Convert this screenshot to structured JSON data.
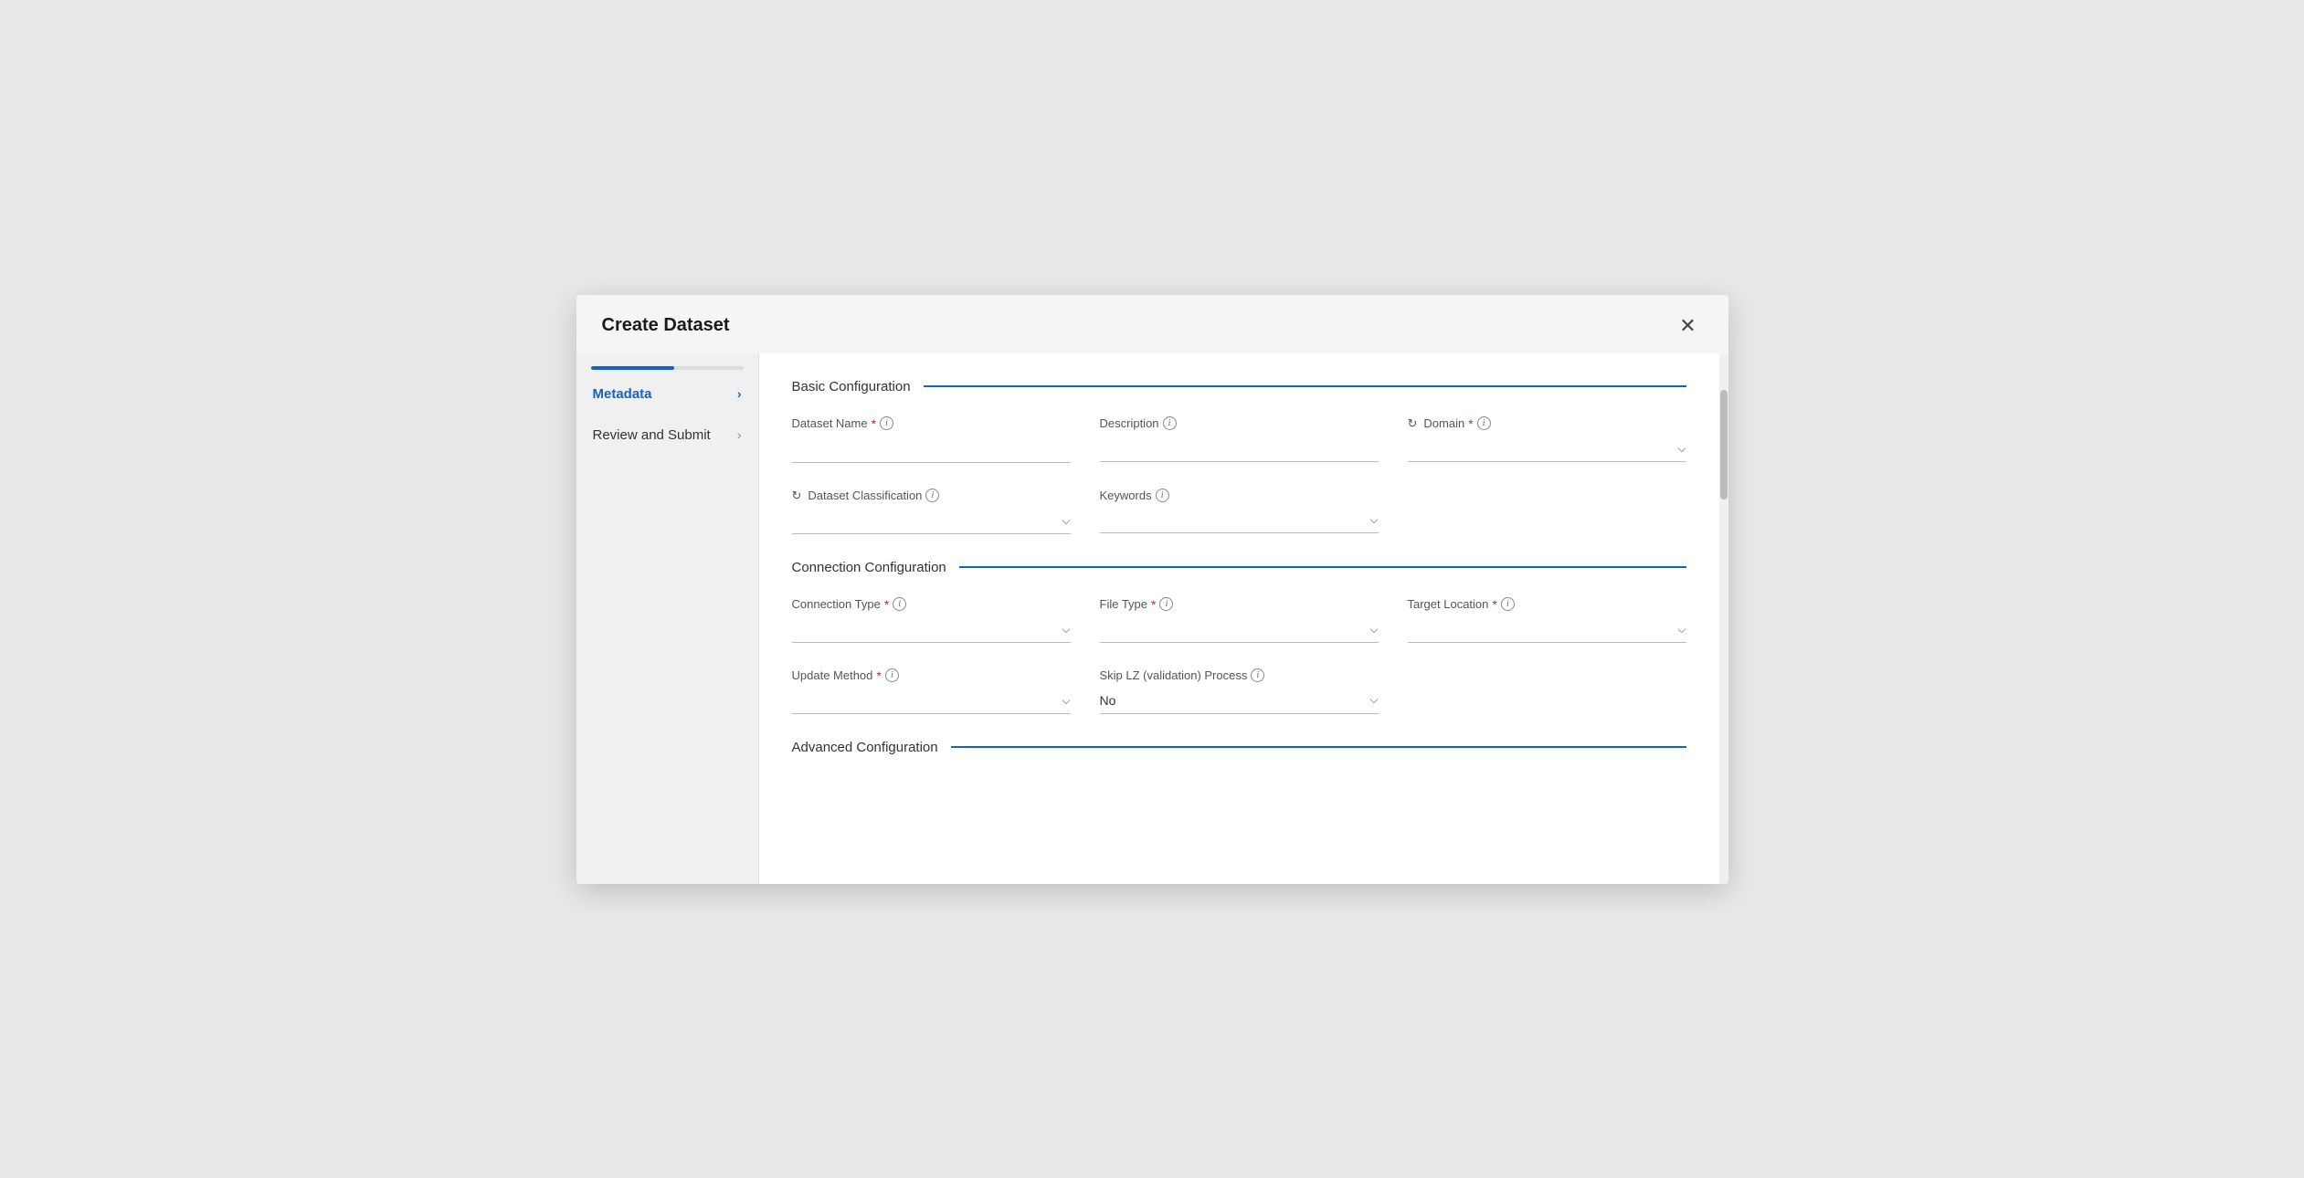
{
  "modal": {
    "title": "Create Dataset",
    "close_label": "×"
  },
  "sidebar": {
    "items": [
      {
        "id": "metadata",
        "label": "Metadata",
        "active": true
      },
      {
        "id": "review",
        "label": "Review and Submit",
        "active": false
      }
    ],
    "progress": 55
  },
  "sections": {
    "basic_config": {
      "title": "Basic Configuration",
      "fields": {
        "dataset_name": {
          "label": "Dataset Name",
          "required": true,
          "has_info": true,
          "type": "input",
          "placeholder": ""
        },
        "description": {
          "label": "Description",
          "required": false,
          "has_info": true,
          "type": "input",
          "placeholder": ""
        },
        "domain": {
          "label": "Domain",
          "required": true,
          "has_info": true,
          "type": "select",
          "has_refresh": true,
          "value": ""
        },
        "dataset_classification": {
          "label": "Dataset Classification",
          "required": false,
          "has_info": true,
          "type": "select",
          "has_refresh": true,
          "value": ""
        },
        "keywords": {
          "label": "Keywords",
          "required": false,
          "has_info": true,
          "type": "select",
          "value": ""
        }
      }
    },
    "connection_config": {
      "title": "Connection Configuration",
      "fields": {
        "connection_type": {
          "label": "Connection Type",
          "required": true,
          "has_info": true,
          "type": "select",
          "value": ""
        },
        "file_type": {
          "label": "File Type",
          "required": true,
          "has_info": true,
          "type": "select",
          "value": ""
        },
        "target_location": {
          "label": "Target Location",
          "required": true,
          "has_info": true,
          "type": "select",
          "value": ""
        },
        "update_method": {
          "label": "Update Method",
          "required": true,
          "has_info": true,
          "type": "select",
          "value": ""
        },
        "skip_lz": {
          "label": "Skip LZ (validation) Process",
          "required": false,
          "has_info": true,
          "type": "select",
          "value": "No"
        }
      }
    },
    "advanced_config": {
      "title": "Advanced Configuration"
    }
  },
  "icons": {
    "chevron_right": "›",
    "chevron_down": "⌄",
    "refresh": "↻",
    "info": "i",
    "close": "✕"
  }
}
